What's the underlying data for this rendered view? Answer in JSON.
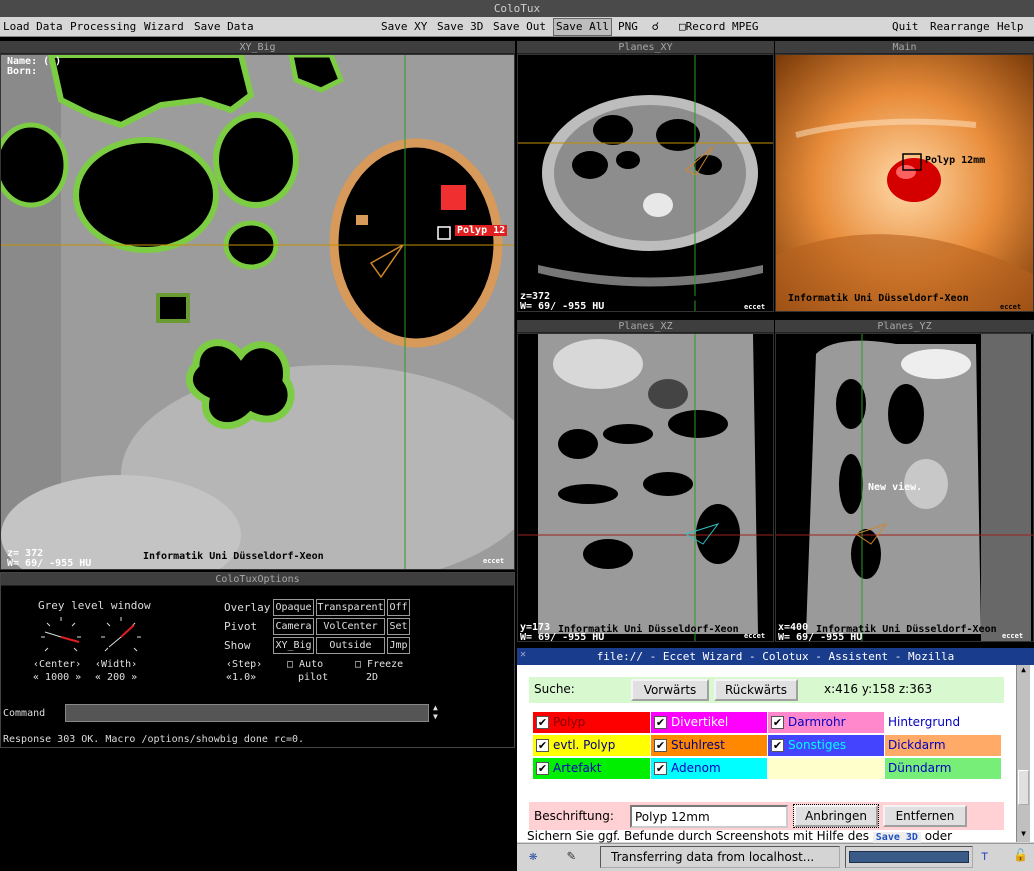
{
  "window": {
    "title": "ColoTux"
  },
  "menu": {
    "left": [
      "Load Data",
      "Processing",
      "Wizard",
      "Save Data"
    ],
    "center": [
      "Save XY",
      "Save 3D",
      "Save Out",
      "Save All",
      "PNG",
      "Record MPEG"
    ],
    "right": [
      "Quit",
      "Rearrange",
      "Help"
    ]
  },
  "panels": {
    "xy_big": {
      "title": "XY_Big",
      "name_label": "Name: ( )",
      "born_label": "Born:",
      "z_label": "z= 372",
      "w_label": "W=   69/ -955 HU",
      "institute": "Informatik Uni Düsseldorf-Xeon",
      "logo": "eccet",
      "polyp_label": "Polyp 12"
    },
    "planes_xy": {
      "title": "Planes_XY",
      "z_label": "z=372",
      "institute": "Informatik Uni Düsseldorf-Xeon",
      "w_label": "W=   69/ -955 HU",
      "logo": "eccet"
    },
    "main": {
      "title": "Main",
      "polyp_label": "Polyp 12mm",
      "institute": "Informatik Uni Düsseldorf-Xeon",
      "logo": "eccet"
    },
    "planes_xz": {
      "title": "Planes_XZ",
      "z_label": "y=173",
      "institute": "Informatik Uni Düsseldorf-Xeon",
      "w_label": "W=   69/ -955 HU",
      "logo": "eccet"
    },
    "planes_yz": {
      "title": "Planes_YZ",
      "z_label": "x=400",
      "institute": "Informatik Uni Düsseldorf-Xeon",
      "w_label": "W=   69/ -955 HU",
      "logo": "eccet",
      "new_view": "New view."
    }
  },
  "options": {
    "title": "ColoTuxOptions",
    "grey_level": "Grey level window",
    "center_label": "Center",
    "center_value": "1000",
    "width_label": "Width",
    "width_value": "200",
    "overlay_label": "Overlay",
    "overlay_buttons": [
      "Opaque",
      "Transparent",
      "Off"
    ],
    "pivot_label": "Pivot",
    "pivot_buttons": [
      "Camera",
      "VolCenter",
      "Set"
    ],
    "show_label": "Show",
    "show_buttons": [
      "XY_Big",
      "Outside",
      "Jmp"
    ],
    "step_label": "Step",
    "step_value": "1.0",
    "autopilot": [
      "Auto",
      "pilot"
    ],
    "freeze": [
      "Freeze",
      "2D"
    ],
    "command_label": "Command",
    "command_value": "",
    "response": "Response 303 OK. Macro /options/showbig done rc=0."
  },
  "browser": {
    "title": "file:// - Eccet Wizard - Colotux - Assistent - Mozilla",
    "search_label": "Suche:",
    "forward": "Vorwärts",
    "backward": "Rückwärts",
    "coords": "x:416  y:158  z:363",
    "categories": [
      {
        "label": "Polyp",
        "checked": true,
        "bg": "#ff0000",
        "color": "#800000"
      },
      {
        "label": "Divertikel",
        "checked": true,
        "bg": "#ff00ff",
        "color": "#ffffff"
      },
      {
        "label": "Darmrohr",
        "checked": true,
        "bg": "#ff88cc",
        "color": "#0000c0"
      },
      {
        "label": "Hintergrund",
        "checked": false,
        "bg": "#ffffff",
        "color": "#0000c0"
      },
      {
        "label": "evtl. Polyp",
        "checked": true,
        "bg": "#ffff00",
        "color": "#000080"
      },
      {
        "label": "Stuhlrest",
        "checked": true,
        "bg": "#ff8800",
        "color": "#000080"
      },
      {
        "label": "Sonstiges",
        "checked": true,
        "bg": "#4444ff",
        "color": "#00ffff"
      },
      {
        "label": "Dickdarm",
        "checked": false,
        "bg": "#ffaa66",
        "color": "#0000c0"
      },
      {
        "label": "Artefakt",
        "checked": true,
        "bg": "#00ee00",
        "color": "#0000c0"
      },
      {
        "label": "Adenom",
        "checked": true,
        "bg": "#00ffff",
        "color": "#0000c0"
      },
      {
        "label": "",
        "checked": false,
        "bg": "#ffffcc",
        "color": "#000000"
      },
      {
        "label": "Dünndarm",
        "checked": false,
        "bg": "#77ee77",
        "color": "#0000c0"
      }
    ],
    "caption_label": "Beschriftung:",
    "caption_value": "Polyp 12mm",
    "attach": "Anbringen",
    "remove": "Entfernen",
    "footer_text": "Sichern Sie ggf. Befunde durch Screenshots mit Hilfe des",
    "footer_link": "Save 3D",
    "footer_end": "oder",
    "status": "Transferring data from localhost..."
  }
}
